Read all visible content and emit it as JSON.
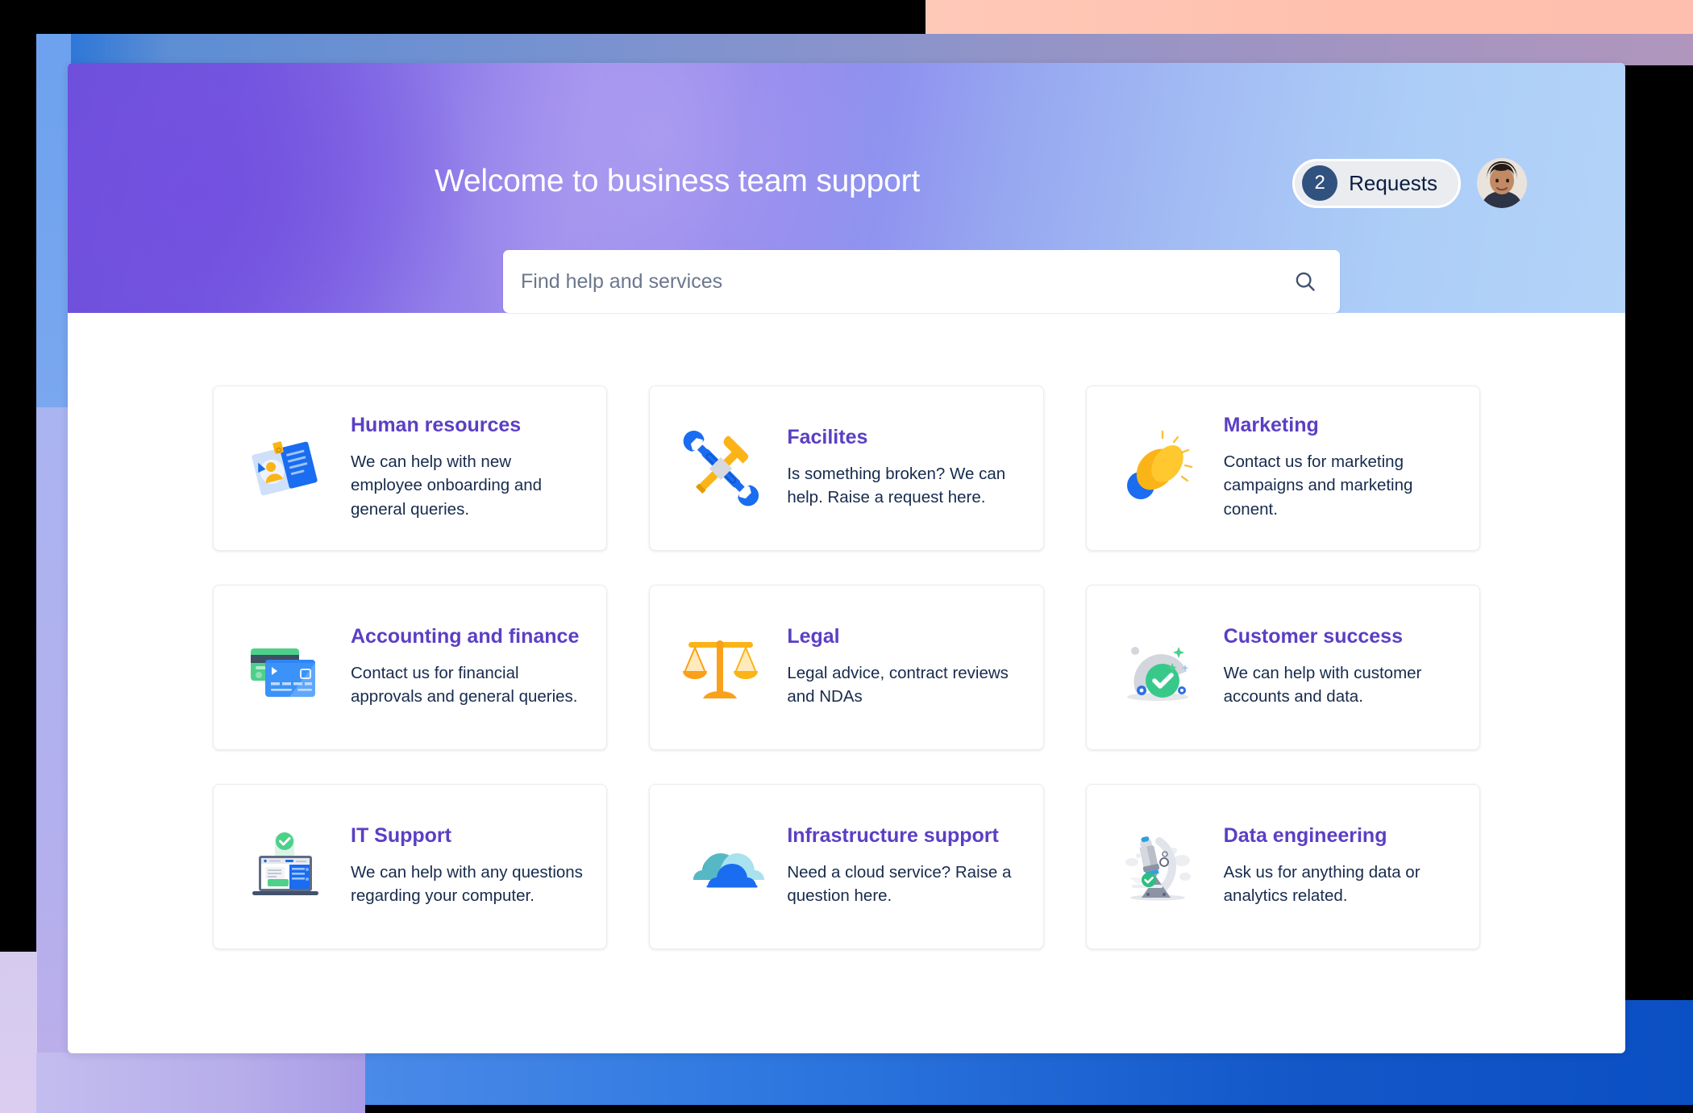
{
  "header": {
    "title": "Welcome to business team support",
    "search": {
      "placeholder": "Find help and services",
      "value": "",
      "icon": "search-icon"
    },
    "requests": {
      "count": "2",
      "label": "Requests"
    },
    "avatar_alt": "User profile photo"
  },
  "colors": {
    "hero_gradient_start": "#6a4fd8",
    "hero_gradient_end": "#b3d3f8",
    "card_title": "#5b3fc4",
    "card_text": "#172b4d",
    "badge_bg": "#31517e",
    "pill_bg": "#ebecf0",
    "panel_bg": "#ffffff",
    "backdrop_peach": "#ffc0ae",
    "backdrop_blue": "#1357c9",
    "backdrop_lavender": "#b3b0ee"
  },
  "cards": [
    {
      "title": "Human resources",
      "description": "We can help with new employee onboarding and general queries.",
      "icon": "id-badge-icon"
    },
    {
      "title": "Facilites",
      "description": "Is something broken? We can help. Raise a request here.",
      "icon": "hammer-wrench-icon"
    },
    {
      "title": "Marketing",
      "description": "Contact us for marketing campaigns and marketing conent.",
      "icon": "megaphone-icon"
    },
    {
      "title": "Accounting and finance",
      "description": "Contact us for financial approvals and general queries.",
      "icon": "credit-cards-icon"
    },
    {
      "title": "Legal",
      "description": "Legal advice, contract reviews and NDAs",
      "icon": "scales-icon"
    },
    {
      "title": "Customer success",
      "description": "We can help with customer accounts and data.",
      "icon": "cloche-check-icon"
    },
    {
      "title": "IT Support",
      "description": "We can help with any questions regarding your computer.",
      "icon": "laptop-check-icon"
    },
    {
      "title": "Infrastructure support",
      "description": "Need a cloud service? Raise a question here.",
      "icon": "cloud-icon"
    },
    {
      "title": "Data engineering",
      "description": "Ask us for anything data or analytics related.",
      "icon": "microscope-icon"
    }
  ]
}
